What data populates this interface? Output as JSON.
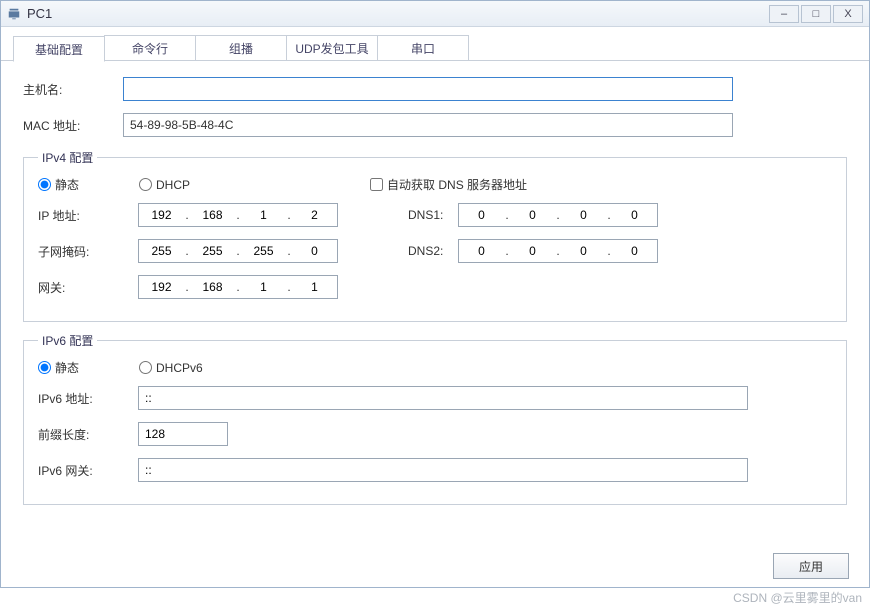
{
  "window": {
    "title": "PC1",
    "minimize": "–",
    "maximize": "□",
    "close": "X"
  },
  "tabs": {
    "basic": "基础配置",
    "cmd": "命令行",
    "multicast": "组播",
    "udp": "UDP发包工具",
    "serial": "串口"
  },
  "fields": {
    "hostname_label": "主机名:",
    "hostname_value": "",
    "mac_label": "MAC 地址:",
    "mac_value": "54-89-98-5B-48-4C"
  },
  "ipv4": {
    "legend": "IPv4 配置",
    "static": "静态",
    "dhcp": "DHCP",
    "auto_dns": "自动获取 DNS 服务器地址",
    "ip_label": "IP 地址:",
    "ip": {
      "o1": "192",
      "o2": "168",
      "o3": "1",
      "o4": "2"
    },
    "mask_label": "子网掩码:",
    "mask": {
      "o1": "255",
      "o2": "255",
      "o3": "255",
      "o4": "0"
    },
    "gw_label": "网关:",
    "gw": {
      "o1": "192",
      "o2": "168",
      "o3": "1",
      "o4": "1"
    },
    "dns1_label": "DNS1:",
    "dns1": {
      "o1": "0",
      "o2": "0",
      "o3": "0",
      "o4": "0"
    },
    "dns2_label": "DNS2:",
    "dns2": {
      "o1": "0",
      "o2": "0",
      "o3": "0",
      "o4": "0"
    }
  },
  "ipv6": {
    "legend": "IPv6 配置",
    "static": "静态",
    "dhcpv6": "DHCPv6",
    "addr_label": "IPv6 地址:",
    "addr_value": "::",
    "prefix_label": "前缀长度:",
    "prefix_value": "128",
    "gw_label": "IPv6 网关:",
    "gw_value": "::"
  },
  "buttons": {
    "apply": "应用"
  },
  "watermark": "CSDN @云里雾里的van"
}
